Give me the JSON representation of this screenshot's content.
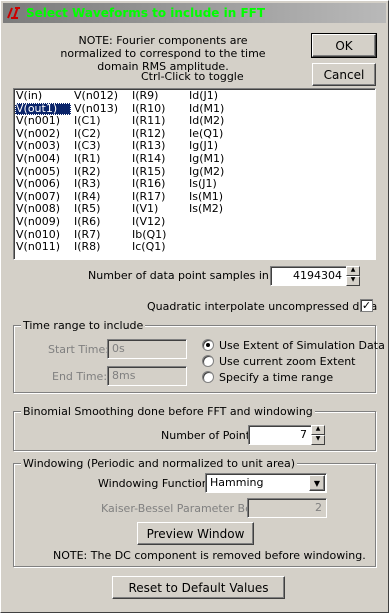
{
  "window": {
    "title": "Select Waveforms to include in FFT"
  },
  "note_top": "NOTE:  Fourier components are normalized to correspond to the time domain RMS amplitude.",
  "ctrl_click": "Ctrl-Click to toggle",
  "buttons": {
    "ok": "OK",
    "cancel": "Cancel",
    "preview": "Preview Window",
    "reset": "Reset to Default Values"
  },
  "waveforms": {
    "col1": [
      "V(in)",
      "V(out1)",
      "V(n001)",
      "V(n002)",
      "V(n003)",
      "V(n004)",
      "V(n005)",
      "V(n006)",
      "V(n007)",
      "V(n008)",
      "V(n009)",
      "V(n010)",
      "V(n011)"
    ],
    "col2": [
      "V(n012)",
      "V(n013)",
      "I(C1)",
      "I(C2)",
      "I(C3)",
      "I(R1)",
      "I(R2)",
      "I(R3)",
      "I(R4)",
      "I(R5)",
      "I(R6)",
      "I(R7)",
      "I(R8)"
    ],
    "col3": [
      "I(R9)",
      "I(R10)",
      "I(R11)",
      "I(R12)",
      "I(R13)",
      "I(R14)",
      "I(R15)",
      "I(R16)",
      "I(R17)",
      "I(V1)",
      "I(V12)",
      "Ib(Q1)",
      "Ic(Q1)"
    ],
    "col4": [
      "Id(J1)",
      "Id(M1)",
      "Id(M2)",
      "Ie(Q1)",
      "Ig(J1)",
      "Ig(M1)",
      "Ig(M2)",
      "Is(J1)",
      "Is(M1)",
      "Is(M2)"
    ],
    "selected": "V(out1)"
  },
  "samples": {
    "label": "Number of data point samples in time:",
    "value": "4194304"
  },
  "quadratic": {
    "label": "Quadratic interpolate uncompressed data",
    "checked": true
  },
  "time_range": {
    "group_label": "Time range to include",
    "start_label": "Start Time:",
    "start_value": "0s",
    "end_label": "End Time:",
    "end_value": "8ms",
    "options": [
      "Use Extent of Simulation Data",
      "Use current zoom Extent",
      "Specify a time range"
    ],
    "selected": "Use Extent of Simulation Data"
  },
  "smoothing": {
    "group_label": "Binomial Smoothing done before FFT and windowing",
    "points_label": "Number of Points:",
    "points_value": "7"
  },
  "windowing": {
    "group_label": "Windowing  (Periodic and normalized to unit area)",
    "function_label": "Windowing Function:",
    "function_value": "Hamming",
    "beta_label": "Kaiser-Bessel Parameter Beta:",
    "beta_value": "2"
  },
  "note_bottom": "NOTE:  The DC component is removed before windowing.",
  "colors": {
    "title_text": "#00ff00",
    "selection": "#0a246a",
    "face": "#d4d0c8",
    "logo": "#cc0000"
  }
}
